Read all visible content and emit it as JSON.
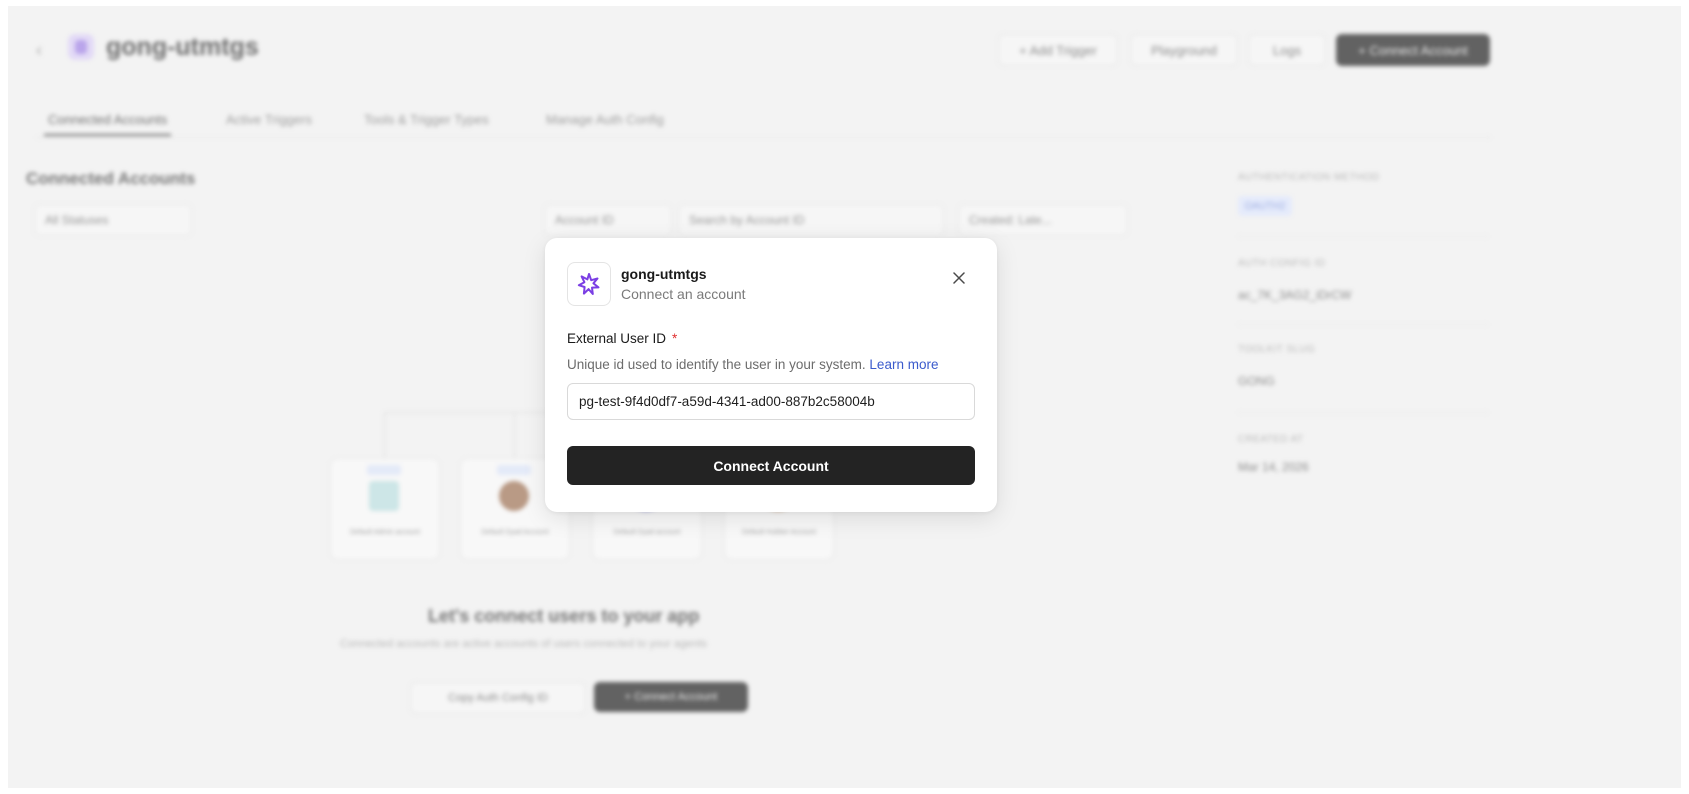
{
  "background": {
    "app_name": "gong-utmtgs",
    "header_buttons": [
      "+ Add Trigger",
      "Playground",
      "Logs",
      "+ Connect Account"
    ],
    "tabs": [
      "Connected Accounts",
      "Active Triggers",
      "Tools & Trigger Types",
      "Manage Auth Config"
    ],
    "section_title": "Connected Accounts",
    "status_filter": "All Statuses",
    "search_scope": "Account ID",
    "search_placeholder": "Search by Account ID",
    "sort": "Created: Late...",
    "sidebar": {
      "auth_label": "AUTHENTICATION METHOD",
      "auth_value": "OAUTH2",
      "config_label": "AUTH CONFIG ID",
      "config_value": "ac_7K_3AG2_iDrCW",
      "toolkit_label": "TOOLKIT SLUG",
      "toolkit_value": "GONG",
      "created_label": "CREATED AT",
      "created_value": "Mar 14, 2026"
    },
    "cards": [
      "Default Admin account",
      "Default Dyad Account",
      "Default Dyad account",
      "Default Hubber Account"
    ],
    "empty_title": "Let's connect users to your app",
    "empty_subtitle": "Connected accounts are active accounts of users connected to your agents",
    "copy_button": "Copy Auth Config ID",
    "connect_button": "+ Connect Account"
  },
  "modal": {
    "title": "gong-utmtgs",
    "subtitle": "Connect an account",
    "field_label": "External User ID",
    "required_mark": "*",
    "help_text": "Unique id used to identify the user in your system.",
    "help_link": "Learn more",
    "input_value": "pg-test-9f4d0df7-a59d-4341-ad00-887b2c58004b",
    "submit_label": "Connect Account",
    "close_icon": "close-icon"
  },
  "colors": {
    "accent_purple": "#7b3fe4",
    "link_blue": "#3b5bcc",
    "required_red": "#e03131",
    "button_dark": "#232323"
  }
}
